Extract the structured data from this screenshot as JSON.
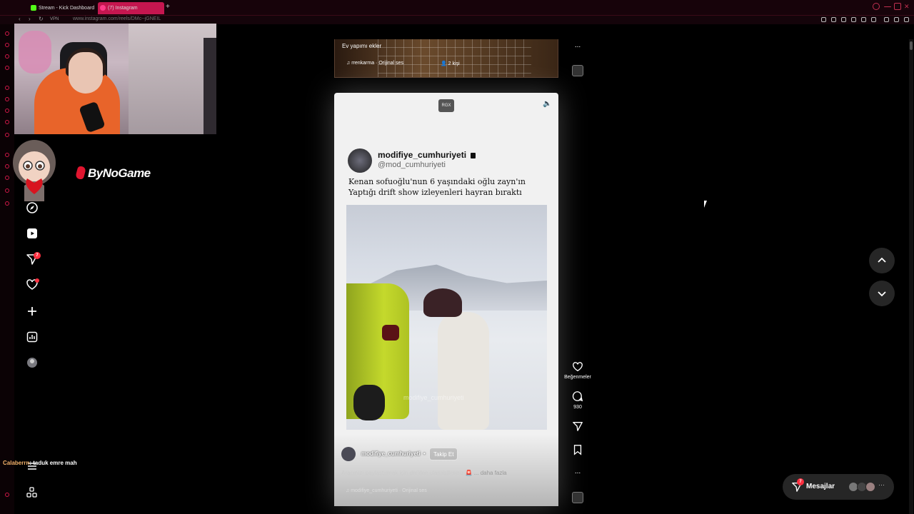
{
  "browser": {
    "tabs": [
      {
        "label": "Stream - Kick Dashboard",
        "favicon": "kick-logo"
      },
      {
        "label": "(7) Instagram",
        "favicon": "instagram-logo",
        "active": true
      }
    ],
    "new_tab": "+",
    "url": "www.instagram.com/reels/DMc--jGNEIL",
    "vpn_badge": "VPN"
  },
  "stream_overlay": {
    "brand": "ByNoGame",
    "chat": {
      "user": "Calaberrn",
      "message": "taduk emre mah"
    }
  },
  "nav": {
    "items": [
      {
        "icon": "explore-icon"
      },
      {
        "icon": "reels-icon"
      },
      {
        "icon": "messages-icon",
        "badge": "7"
      },
      {
        "icon": "notifications-heart-icon",
        "dot": true
      },
      {
        "icon": "create-plus-icon"
      },
      {
        "icon": "dashboard-chart-icon"
      },
      {
        "icon": "profile-avatar"
      }
    ],
    "menu_icon": "hamburger-icon",
    "more_icon": "apps-grid-icon"
  },
  "previous_reel": {
    "caption": "Ev yapımı ekler",
    "audio": "rrenkarma · Orijinal ses",
    "people": "2 kişi"
  },
  "reel": {
    "overlay_badge": "RGX",
    "tweet": {
      "name": "modifiye_cumhuriyeti",
      "handle": "@mod_cumhuriyeti",
      "text": "Kenan sofuoğlu'nun 6 yaşındaki oğlu zayn'ın Yaptığı drift show izleyenleri hayran bıraktı"
    },
    "video_watermark": "modifiye_cumhuriyeti",
    "author": "modifiye_cumhuriyeti",
    "separator": "•",
    "follow_label": "Takip Et",
    "caption": "Aracınızı paylaştırmak için dm'den ulaşabilirsiniz 🚨",
    "more_label": "... daha fazla",
    "audio": "modifiye_cumhuriyeti · Orijinal ses"
  },
  "actions": {
    "like_label": "Beğenmeler",
    "comment_count": "930",
    "more": "..."
  },
  "messages": {
    "label": "Mesajlar",
    "badge": "7",
    "more": "···"
  },
  "colors": {
    "accent_red": "#ff3040",
    "tab_active": "#c4164f",
    "kick_green": "#53fc18"
  }
}
